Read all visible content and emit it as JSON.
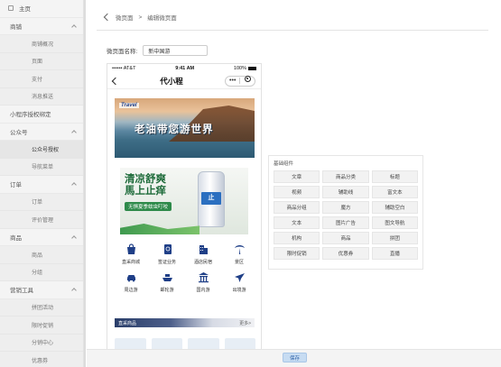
{
  "sidebar": {
    "home": "主页",
    "groups": [
      {
        "label": "商铺",
        "items": [
          "商铺概况",
          "页面",
          "支付",
          "消息推送"
        ]
      },
      {
        "label": "小程序授权绑定",
        "items": []
      },
      {
        "label": "公众号",
        "items": [
          "公众号授权",
          "导航菜单"
        ]
      },
      {
        "label": "订单",
        "items": [
          "订单",
          "评价管理"
        ]
      },
      {
        "label": "商品",
        "items": [
          "商品",
          "分组"
        ]
      },
      {
        "label": "营销工具",
        "items": [
          "拼团活动",
          "限时促销",
          "分销中心",
          "优惠券"
        ]
      }
    ]
  },
  "breadcrumb": {
    "root": "微页面",
    "sep": ">",
    "current": "编辑微页面"
  },
  "form": {
    "name_label": "微页面名称:",
    "name_value": "新中国游"
  },
  "phone": {
    "carrier": "•••••• AT&T",
    "time": "9:41 AM",
    "battery": "100%",
    "title": "代小程",
    "capsule_more": "•••",
    "banner1_text": "老油带您游世界",
    "banner2_line1": "清凉舒爽",
    "banner2_line2": "馬上止痒",
    "banner2_tag": "无惧夏季蚊虫叮咬",
    "can_label": "止",
    "grid": [
      {
        "label": "直采商城",
        "icon": "shopping-bag-icon"
      },
      {
        "label": "签证业务",
        "icon": "passport-icon"
      },
      {
        "label": "酒店民宿",
        "icon": "hotel-icon"
      },
      {
        "label": "景区",
        "icon": "palm-tree-icon"
      },
      {
        "label": "周边游",
        "icon": "car-icon"
      },
      {
        "label": "邮轮游",
        "icon": "ship-icon"
      },
      {
        "label": "国内游",
        "icon": "temple-icon"
      },
      {
        "label": "出境游",
        "icon": "airplane-icon"
      }
    ],
    "strip_left": "直采商品",
    "strip_right": "更多>"
  },
  "components": {
    "title": "基础组件",
    "items": [
      "文章",
      "商品分类",
      "标题",
      "视频",
      "辅助线",
      "富文本",
      "商品分组",
      "魔方",
      "辅助空白",
      "文本",
      "图片广告",
      "图文导航",
      "机构",
      "商品",
      "拼团",
      "限时促销",
      "优惠券",
      "直播"
    ]
  },
  "footer": {
    "save": "保存"
  },
  "colors": {
    "accent": "#2b6fc0",
    "icon_navy": "#1f3f87"
  }
}
